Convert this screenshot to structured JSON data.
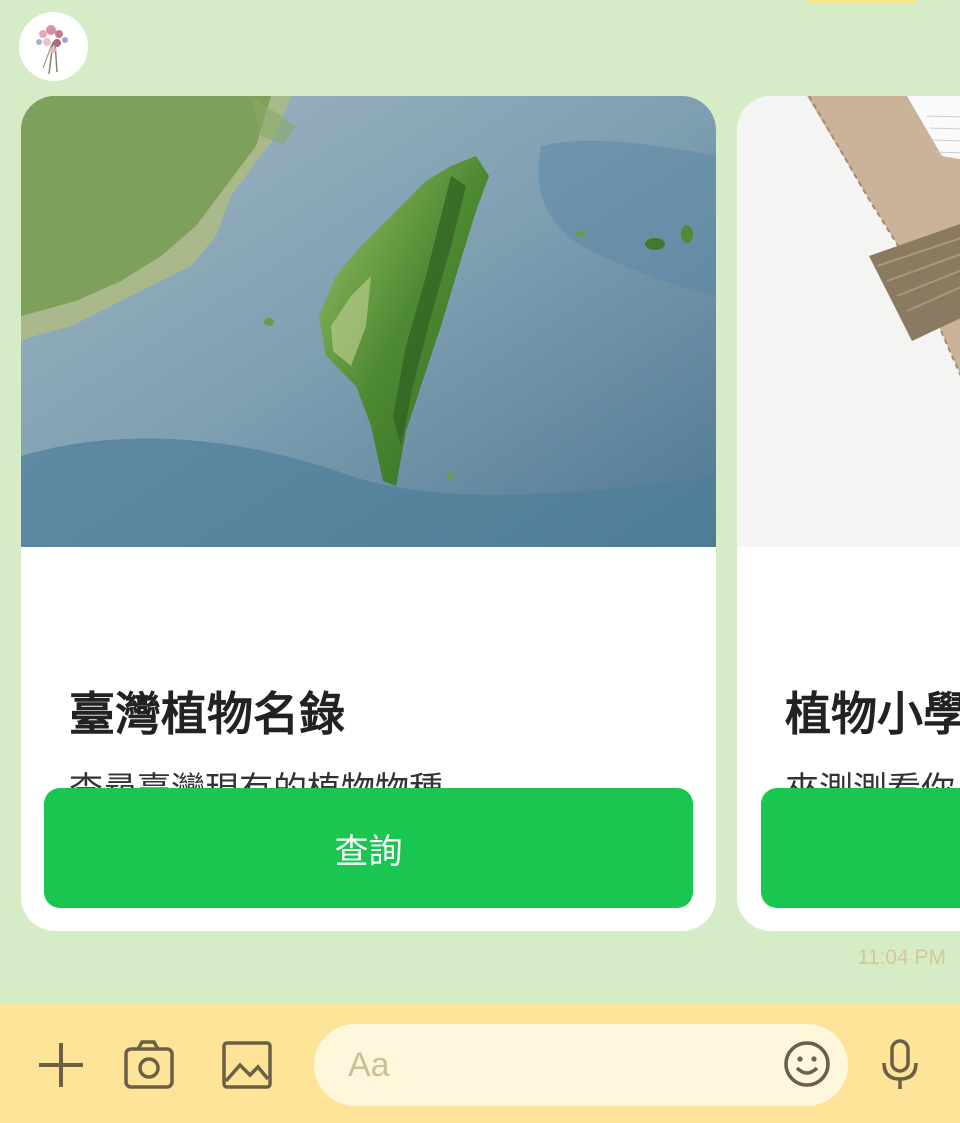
{
  "chat": {
    "cards": [
      {
        "title": "臺灣植物名錄",
        "description": "查尋臺灣現有的植物物種",
        "button_label": "查詢",
        "image": "taiwan-satellite-map"
      },
      {
        "title": "植物小學",
        "description": "來測測看你\n植物的問題",
        "button_label": "",
        "image": "notebook-photo"
      }
    ],
    "timestamp": "11:04 PM"
  },
  "input_bar": {
    "placeholder": "Aa",
    "icons": [
      "plus-icon",
      "camera-icon",
      "image-icon",
      "emoji-icon",
      "microphone-icon"
    ]
  },
  "colors": {
    "chat_background": "#d5ecc7",
    "button_green": "#19c64f",
    "bottom_bar": "#fde498",
    "input_background": "#fff7dc"
  }
}
